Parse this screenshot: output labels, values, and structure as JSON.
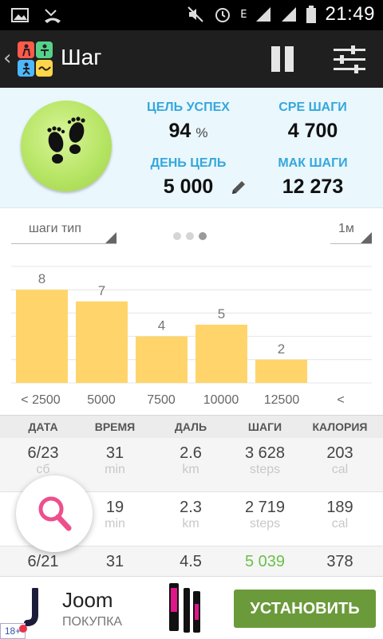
{
  "status_bar": {
    "time": "21:49",
    "network_type": "E"
  },
  "app_bar": {
    "title": "Шаг"
  },
  "summary": {
    "goal_success": {
      "label": "ЦЕЛЬ УСПЕХ",
      "value": "94",
      "unit": "%"
    },
    "avg_steps": {
      "label": "СРЕ ШАГИ",
      "value": "4 700"
    },
    "day_goal": {
      "label": "ДЕНЬ ЦЕЛЬ",
      "value": "5 000"
    },
    "max_steps": {
      "label": "МАК ШАГИ",
      "value": "12 273"
    }
  },
  "controls": {
    "type_dropdown": "шаги тип",
    "period_dropdown": "1м",
    "page_indicator": {
      "count": 3,
      "active": 2
    }
  },
  "chart_data": {
    "type": "bar",
    "categories": [
      "< 2500",
      "5000",
      "7500",
      "10000",
      "12500",
      "<"
    ],
    "values": [
      8,
      7,
      4,
      5,
      2,
      null
    ],
    "ylim": [
      0,
      10
    ],
    "grid": true,
    "bar_color": "#ffd56b"
  },
  "table": {
    "headers": [
      "ДАТА",
      "ВРЕМЯ",
      "ДАЛЬ",
      "ШАГИ",
      "КАЛОРИЯ"
    ],
    "rows": [
      {
        "date": "6/23",
        "day": "сб",
        "time": "31",
        "time_unit": "min",
        "dist": "2.6",
        "dist_unit": "km",
        "steps": "3 628",
        "steps_unit": "steps",
        "cal": "203",
        "cal_unit": "cal"
      },
      {
        "date": "",
        "day": "",
        "time": "19",
        "time_unit": "min",
        "dist": "2.3",
        "dist_unit": "km",
        "steps": "2 719",
        "steps_unit": "steps",
        "cal": "189",
        "cal_unit": "cal"
      },
      {
        "date": "6/21",
        "day": "",
        "time": "31",
        "time_unit": "",
        "dist": "4.5",
        "dist_unit": "",
        "steps": "5 039",
        "steps_unit": "",
        "cal": "378",
        "cal_unit": "",
        "steps_color": "#6cc04a"
      }
    ]
  },
  "ad": {
    "brand": "Joom",
    "subtitle": "ПОКУПКА",
    "cta": "УСТАНОВИТЬ",
    "age": "18+"
  },
  "colors": {
    "accent_blue": "#35a7dc",
    "green_button": "#b7e565",
    "install_green": "#6a9a3a",
    "pink_search": "#ee4f8c"
  }
}
